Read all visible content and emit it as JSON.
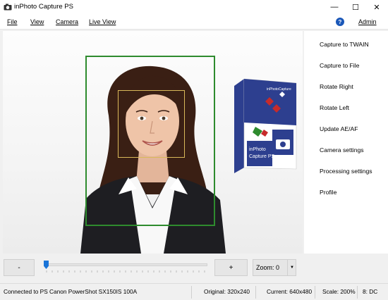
{
  "window": {
    "title": "inPhoto Capture PS",
    "minimize_glyph": "—",
    "maximize_glyph": "☐",
    "close_glyph": "✕"
  },
  "menu": {
    "items": [
      {
        "label": "File"
      },
      {
        "label": "View"
      },
      {
        "label": "Camera"
      },
      {
        "label": "Live View"
      }
    ],
    "help_glyph": "?",
    "admin_label": "Admin"
  },
  "product_box": {
    "brand": "inPhotoCapture",
    "name_line1": "inPhoto",
    "name_line2": "Capture PS",
    "colors": {
      "blue": "#2d3f8f",
      "red": "#c62b2b",
      "green": "#2e8b2e"
    }
  },
  "sidebar": {
    "items": [
      {
        "label": "Capture to TWAIN"
      },
      {
        "label": "Capture to File"
      },
      {
        "label": "Rotate Right"
      },
      {
        "label": "Rotate Left"
      },
      {
        "label": "Update AE/AF"
      },
      {
        "label": "Camera settings"
      },
      {
        "label": "Processing settings"
      },
      {
        "label": "Profile"
      }
    ]
  },
  "zoom": {
    "minus_label": "-",
    "plus_label": "+",
    "zoom_label": "Zoom: 0",
    "slider_value": 0
  },
  "status": {
    "connection": "Connected to PS Canon PowerShot SX150IS 100A",
    "original": "Original: 320x240",
    "current": "Current: 640x480",
    "scale": "Scale: 200%",
    "mode": "8: DC"
  },
  "colors": {
    "face_frame_outer": "#2e8b2e",
    "face_frame_inner": "#d9b95a",
    "slider_thumb": "#1a74d8",
    "help_icon": "#1a57b8"
  }
}
